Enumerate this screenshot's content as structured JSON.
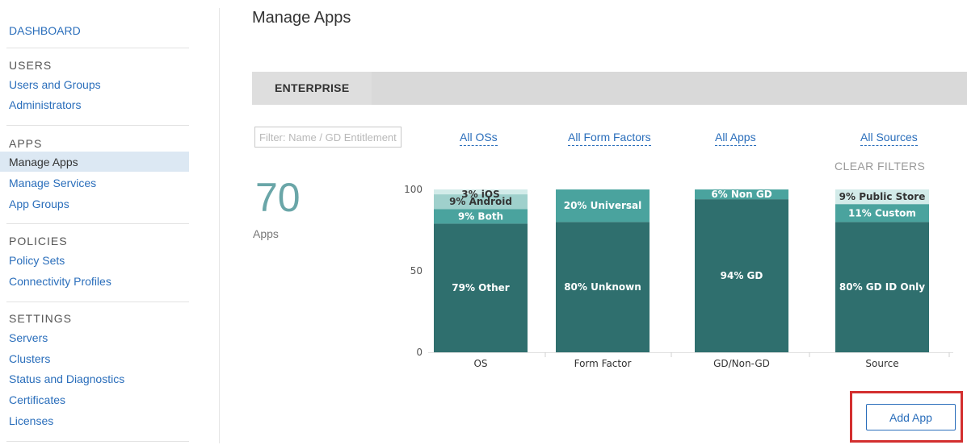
{
  "sidebar": {
    "dashboard": "DASHBOARD",
    "sections": [
      {
        "heading": "USERS",
        "items": [
          "Users and Groups",
          "Administrators"
        ]
      },
      {
        "heading": "APPS",
        "items": [
          "Manage Apps",
          "Manage Services",
          "App Groups"
        ]
      },
      {
        "heading": "POLICIES",
        "items": [
          "Policy Sets",
          "Connectivity Profiles"
        ]
      },
      {
        "heading": "SETTINGS",
        "items": [
          "Servers",
          "Clusters",
          "Status and Diagnostics",
          "Certificates",
          "Licenses"
        ]
      }
    ],
    "active_item": "Manage Apps"
  },
  "page": {
    "title": "Manage Apps"
  },
  "tabs": [
    {
      "label": "ENTERPRISE",
      "active": true
    }
  ],
  "filters": {
    "search_placeholder": "Filter: Name / GD Entitlement ID",
    "os": "All OSs",
    "form_factor": "All Form Factors",
    "apps": "All Apps",
    "sources": "All Sources",
    "clear": "CLEAR FILTERS"
  },
  "summary": {
    "count": "70",
    "label": "Apps"
  },
  "actions": {
    "add_app": "Add App"
  },
  "colors": {
    "link": "#2a6ebb",
    "dark_teal": "#2f6f6e",
    "mid_teal": "#4aa39e",
    "light_teal": "#9fd0cc",
    "pale_teal": "#d2ebe9",
    "highlight": "#d32f2f"
  },
  "chart_data": {
    "type": "bar",
    "stacked": true,
    "ylim": [
      0,
      100
    ],
    "yticks": [
      0,
      50,
      100
    ],
    "categories": [
      "OS",
      "Form Factor",
      "GD/Non-GD",
      "Source"
    ],
    "bars": [
      {
        "category": "OS",
        "segments": [
          {
            "label": "79% Other",
            "value": 79
          },
          {
            "label": "9% Both",
            "value": 9
          },
          {
            "label": "9% Android",
            "value": 9
          },
          {
            "label": "3% iOS",
            "value": 3
          }
        ]
      },
      {
        "category": "Form Factor",
        "segments": [
          {
            "label": "80% Unknown",
            "value": 80
          },
          {
            "label": "20% Universal",
            "value": 20
          }
        ]
      },
      {
        "category": "GD/Non-GD",
        "segments": [
          {
            "label": "94% GD",
            "value": 94
          },
          {
            "label": "6% Non GD",
            "value": 6
          }
        ]
      },
      {
        "category": "Source",
        "segments": [
          {
            "label": "80% GD ID Only",
            "value": 80
          },
          {
            "label": "11% Custom",
            "value": 11
          },
          {
            "label": "9% Public Store",
            "value": 9
          }
        ]
      }
    ]
  }
}
